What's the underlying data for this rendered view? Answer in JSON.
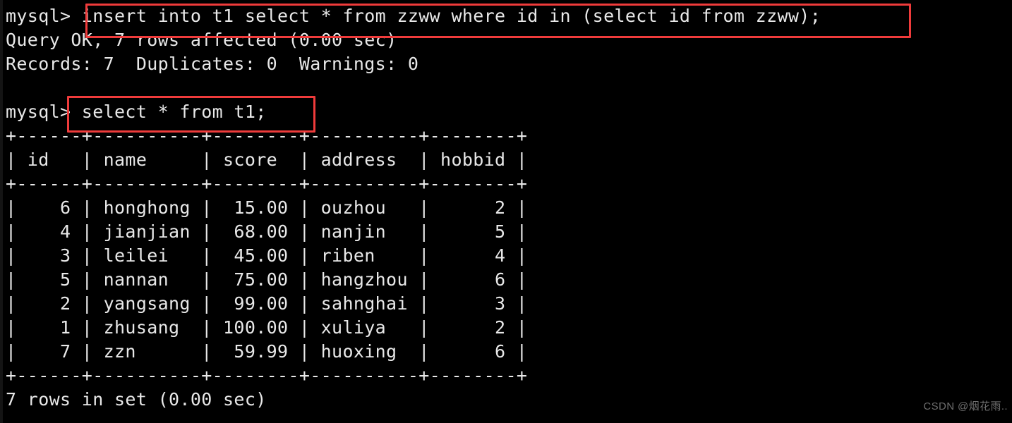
{
  "terminal": {
    "prompt": "mysql>",
    "background_color": "#000000",
    "text_color": "#e8e8e8",
    "highlight_color": "#ef3b3b",
    "lines": [
      "mysql> insert into t1 select * from zzww where id in (select id from zzww);",
      "Query OK, 7 rows affected (0.00 sec)",
      "Records: 7  Duplicates: 0  Warnings: 0",
      "",
      "mysql> select * from t1;",
      "+------+----------+--------+----------+--------+",
      "| id   | name     | score  | address  | hobbid |",
      "+------+----------+--------+----------+--------+",
      "|    6 | honghong |  15.00 | ouzhou   |      2 |",
      "|    4 | jianjian |  68.00 | nanjin   |      5 |",
      "|    3 | leilei   |  45.00 | riben    |      4 |",
      "|    5 | nannan   |  75.00 | hangzhou |      6 |",
      "|    2 | yangsang |  99.00 | sahnghai |      3 |",
      "|    1 | zhusang  | 100.00 | xuliya   |      2 |",
      "|    7 | zzn      |  59.99 | huoxing  |      6 |",
      "+------+----------+--------+----------+--------+",
      "7 rows in set (0.00 sec)"
    ]
  },
  "commands": {
    "insert_statement": "insert into t1 select * from zzww where id in (select id from zzww);",
    "select_statement": "> select * from t1;"
  },
  "result_messages": {
    "query_ok": "Query OK, 7 rows affected (0.00 sec)",
    "records": "Records: 7  Duplicates: 0  Warnings: 0",
    "rows_in_set": "7 rows in set (0.00 sec)"
  },
  "table": {
    "border": "+------+----------+--------+----------+--------+",
    "columns": [
      "id",
      "name",
      "score",
      "address",
      "hobbid"
    ],
    "rows": [
      [
        "6",
        "honghong",
        "15.00",
        "ouzhou",
        "2"
      ],
      [
        "4",
        "jianjian",
        "68.00",
        "nanjin",
        "5"
      ],
      [
        "3",
        "leilei",
        "45.00",
        "riben",
        "4"
      ],
      [
        "5",
        "nannan",
        "75.00",
        "hangzhou",
        "6"
      ],
      [
        "2",
        "yangsang",
        "99.00",
        "sahnghai",
        "3"
      ],
      [
        "1",
        "zhusang",
        "100.00",
        "xuliya",
        "2"
      ],
      [
        "7",
        "zzn",
        "59.99",
        "huoxing",
        "6"
      ]
    ],
    "row_count": 7
  },
  "watermark": {
    "text": "CSDN @烟花雨.."
  }
}
